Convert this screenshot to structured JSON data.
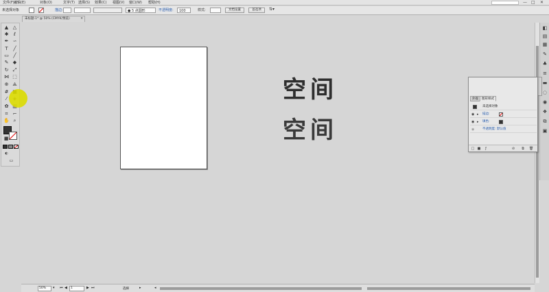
{
  "menubar": {
    "items": [
      "文件(F)",
      "编辑(E)",
      "对象(O)",
      "文字(T)",
      "选择(S)",
      "效果(C)",
      "视图(V)",
      "窗口(W)",
      "帮助(H)"
    ],
    "window_controls": [
      "—",
      "□",
      "✕"
    ]
  },
  "control_bar": {
    "selection_label": "未选择对象",
    "stroke_label": "描边:",
    "brush_label": "● 5 点圆形",
    "opacity_label": "不透明度:",
    "opacity_value": "100",
    "style_label": "样式:",
    "doc_setup_label": "文档设置",
    "prefs_label": "首选项"
  },
  "document_tab": {
    "title": "未标题-1* @ 50% (CMYK/预览)",
    "close": "✕"
  },
  "canvas": {
    "text_1": "空间",
    "text_2": "空间"
  },
  "layers_panel": {
    "tabs_back": [
      "透明",
      "渐变",
      "描边属性"
    ],
    "tabs_front": [
      "外观",
      "图形样式"
    ],
    "header_label": "未选择对象",
    "rows": [
      {
        "label": "未选择对象"
      },
      {
        "label": "描边:"
      },
      {
        "label": "填色:"
      },
      {
        "label": "不透明度: 默认值"
      }
    ]
  },
  "status_bar": {
    "zoom": "50%",
    "page": "1",
    "tool": "选择"
  },
  "colors": {
    "accent_blue": "#2a5fb0",
    "cursor_highlight": "#dcdc00"
  }
}
